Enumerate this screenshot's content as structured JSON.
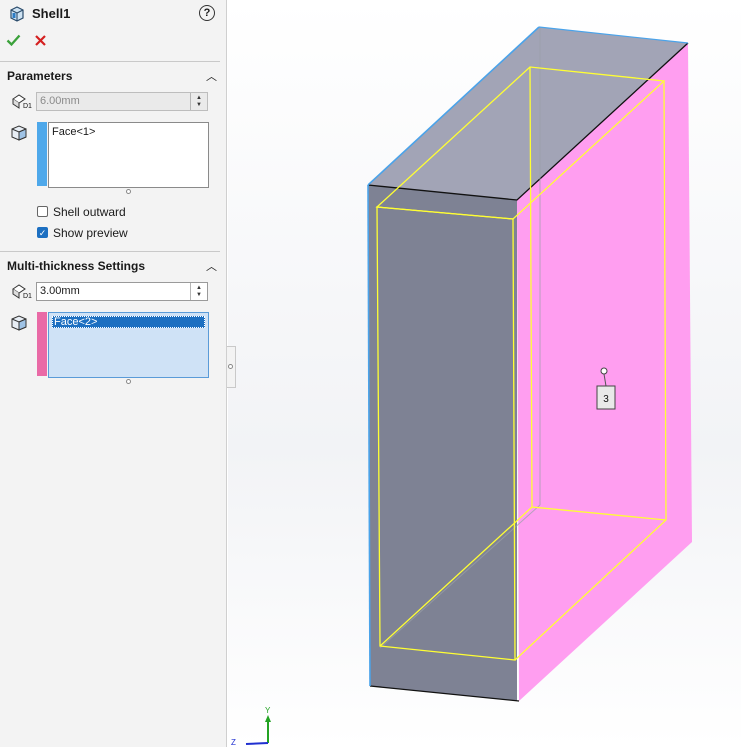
{
  "header": {
    "title": "Shell1",
    "help_icon": "question-circle-icon",
    "ok_icon": "checkmark-icon",
    "cancel_icon": "x-icon",
    "colors": {
      "ok": "#3aa13a",
      "cancel": "#d42020"
    }
  },
  "parameters": {
    "title": "Parameters",
    "thickness": {
      "value": "6.00mm"
    },
    "faces": [
      "Face<1>"
    ],
    "face_color": "#4ea8ea",
    "shell_outward": {
      "label": "Shell outward",
      "checked": false
    },
    "show_preview": {
      "label": "Show preview",
      "checked": true
    }
  },
  "multi": {
    "title": "Multi-thickness Settings",
    "thickness": {
      "value": "3.00mm"
    },
    "faces": [
      "Face<2>"
    ],
    "face_color": "#e96aa6"
  },
  "viewport": {
    "callout": "3",
    "triad": {
      "y": "Y",
      "z": "Z"
    },
    "colors": {
      "pink_face": "#ff9ef0",
      "gray_face": "#7e8294",
      "preview": "#ffff33"
    }
  }
}
